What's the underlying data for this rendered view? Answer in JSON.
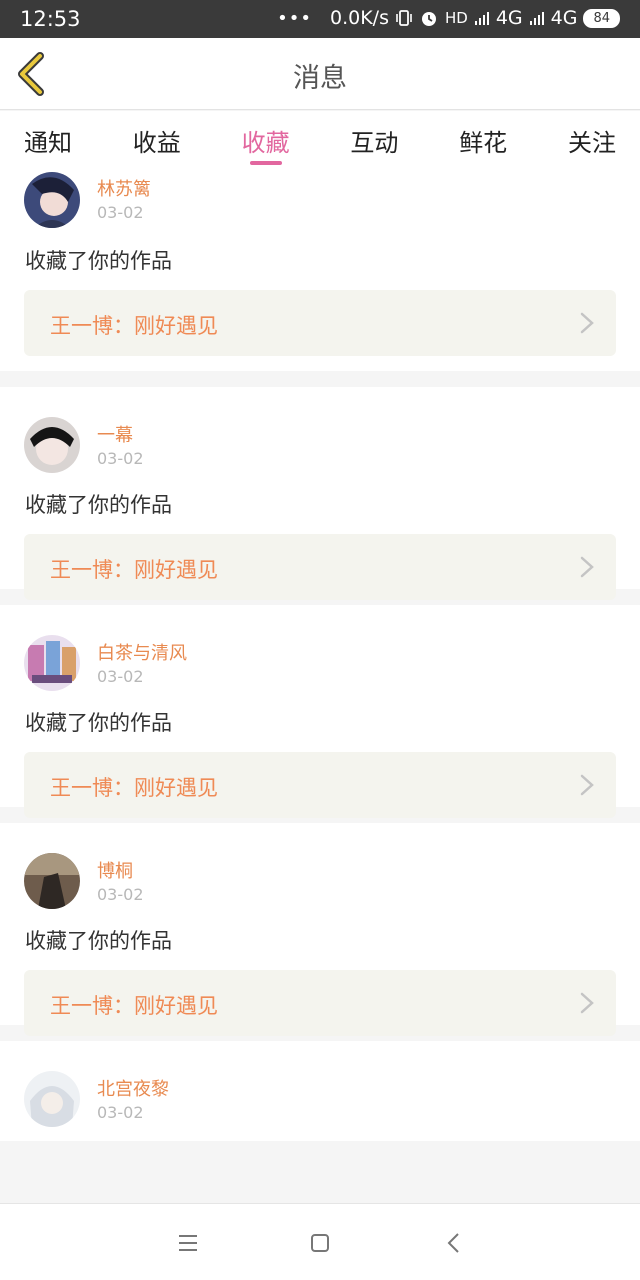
{
  "status_bar": {
    "time": "12:53",
    "dots": "•••",
    "speed": "0.0K/s",
    "hd": "HD",
    "net1": "4G",
    "net2": "4G",
    "battery": "84"
  },
  "header": {
    "title": "消息"
  },
  "tabs": [
    {
      "label": "通知"
    },
    {
      "label": "收益"
    },
    {
      "label": "收藏"
    },
    {
      "label": "互动"
    },
    {
      "label": "鲜花"
    },
    {
      "label": "关注"
    }
  ],
  "active_tab": "收藏",
  "items": [
    {
      "user": "林苏篱",
      "date": "03-02",
      "action": "收藏了你的作品",
      "work": "王一博：刚好遇见"
    },
    {
      "user": "一幕",
      "date": "03-02",
      "action": "收藏了你的作品",
      "work": "王一博：刚好遇见"
    },
    {
      "user": "白茶与清风",
      "date": "03-02",
      "action": "收藏了你的作品",
      "work": "王一博：刚好遇见"
    },
    {
      "user": "博桐",
      "date": "03-02",
      "action": "收藏了你的作品",
      "work": "王一博：刚好遇见"
    },
    {
      "user": "北宫夜黎",
      "date": "03-02"
    }
  ],
  "colors": {
    "accent_pink": "#e2679f",
    "username_orange": "#e88a50",
    "work_orange": "#ef8a55",
    "back_icon_yellow": "#e9c93c"
  }
}
